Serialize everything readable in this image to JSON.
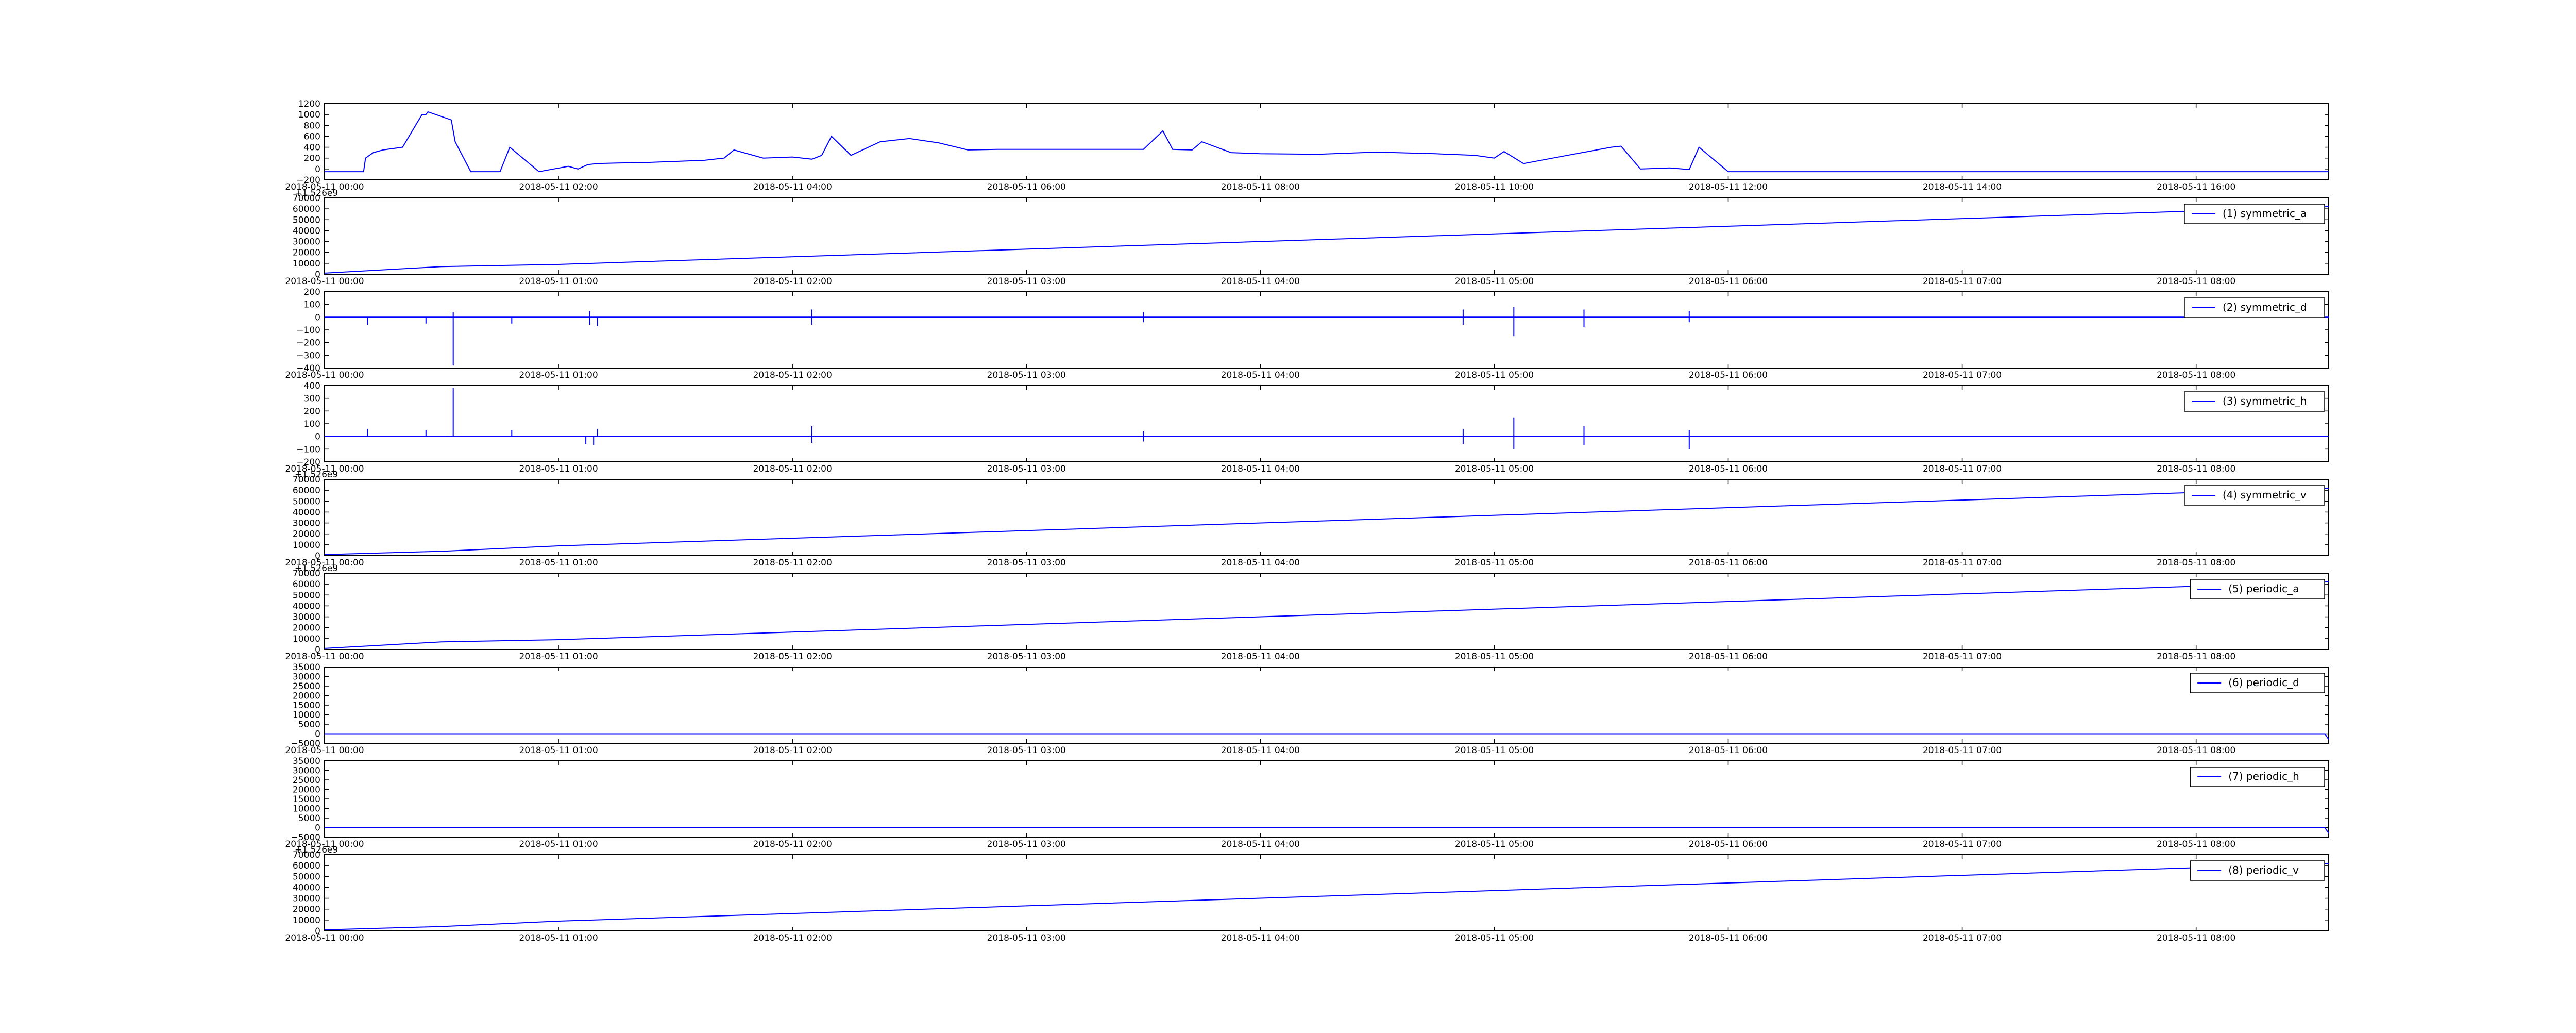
{
  "figure": {
    "background": "#ffffff",
    "line_color": "#0000ff",
    "frame_color": "#000000"
  },
  "chart_data": [
    {
      "type": "line",
      "x_unit": "datetime",
      "xticks": [
        "2018-05-11 00:00",
        "2018-05-11 02:00",
        "2018-05-11 04:00",
        "2018-05-11 06:00",
        "2018-05-11 08:00",
        "2018-05-11 10:00",
        "2018-05-11 12:00",
        "2018-05-11 14:00",
        "2018-05-11 16:00"
      ],
      "xlim": [
        "2018-05-11 00:00",
        "2018-05-11 17:08"
      ],
      "yticks": [
        "1200",
        "1000",
        "800",
        "600",
        "400",
        "200",
        "0",
        "−200"
      ],
      "ylim": [
        -200,
        1200
      ],
      "offset_text": "",
      "grid": false,
      "legend": null,
      "series": [
        {
          "x": [
            "2018-05-11 00:00",
            "2018-05-11 00:20",
            "2018-05-11 00:21",
            "2018-05-11 00:25",
            "2018-05-11 00:30",
            "2018-05-11 00:40",
            "2018-05-11 00:50",
            "2018-05-11 00:52",
            "2018-05-11 00:53",
            "2018-05-11 01:05",
            "2018-05-11 01:06",
            "2018-05-11 01:07",
            "2018-05-11 01:15",
            "2018-05-11 01:30",
            "2018-05-11 01:35",
            "2018-05-11 01:50",
            "2018-05-11 02:05",
            "2018-05-11 02:10",
            "2018-05-11 02:15",
            "2018-05-11 02:20",
            "2018-05-11 02:30",
            "2018-05-11 02:45",
            "2018-05-11 03:00",
            "2018-05-11 03:15",
            "2018-05-11 03:25",
            "2018-05-11 03:30",
            "2018-05-11 03:45",
            "2018-05-11 04:00",
            "2018-05-11 04:10",
            "2018-05-11 04:15",
            "2018-05-11 04:20",
            "2018-05-11 04:30",
            "2018-05-11 04:45",
            "2018-05-11 05:00",
            "2018-05-11 05:15",
            "2018-05-11 05:30",
            "2018-05-11 05:45",
            "2018-05-11 06:00",
            "2018-05-11 06:30",
            "2018-05-11 07:00",
            "2018-05-11 07:10",
            "2018-05-11 07:15",
            "2018-05-11 07:25",
            "2018-05-11 07:30",
            "2018-05-11 07:45",
            "2018-05-11 08:00",
            "2018-05-11 08:30",
            "2018-05-11 09:00",
            "2018-05-11 09:30",
            "2018-05-11 09:50",
            "2018-05-11 10:00",
            "2018-05-11 10:05",
            "2018-05-11 10:15",
            "2018-05-11 10:30",
            "2018-05-11 10:45",
            "2018-05-11 11:00",
            "2018-05-11 11:05",
            "2018-05-11 11:15",
            "2018-05-11 11:30",
            "2018-05-11 11:40",
            "2018-05-11 11:45",
            "2018-05-11 12:00",
            "2018-05-11 14:00",
            "2018-05-11 17:08"
          ],
          "y": [
            -50,
            -50,
            200,
            300,
            350,
            400,
            1000,
            1000,
            1050,
            900,
            700,
            500,
            -50,
            -50,
            400,
            -50,
            50,
            0,
            80,
            100,
            110,
            120,
            140,
            160,
            200,
            350,
            200,
            220,
            180,
            250,
            600,
            250,
            500,
            560,
            480,
            350,
            360,
            360,
            360,
            360,
            700,
            360,
            350,
            500,
            300,
            280,
            270,
            310,
            280,
            250,
            200,
            320,
            100,
            200,
            300,
            400,
            420,
            0,
            20,
            -10,
            400,
            -50,
            -50,
            -50
          ]
        }
      ]
    },
    {
      "type": "line",
      "xticks": [
        "2018-05-11 00:00",
        "2018-05-11 01:00",
        "2018-05-11 02:00",
        "2018-05-11 03:00",
        "2018-05-11 04:00",
        "2018-05-11 05:00",
        "2018-05-11 06:00",
        "2018-05-11 07:00",
        "2018-05-11 08:00"
      ],
      "xlim": [
        "2018-05-11 00:00",
        "2018-05-11 08:34"
      ],
      "yticks": [
        "70000",
        "60000",
        "50000",
        "40000",
        "30000",
        "20000",
        "10000",
        "0"
      ],
      "ylim": [
        0,
        70000
      ],
      "offset_text": "+1.526e9",
      "grid": false,
      "legend": {
        "label": "(1) symmetric_a",
        "position": "top-right"
      },
      "series": [
        {
          "name": "(1) symmetric_a",
          "x": [
            "2018-05-11 00:00",
            "2018-05-11 00:30",
            "2018-05-11 01:00",
            "2018-05-11 08:34"
          ],
          "y": [
            1000,
            7000,
            9000,
            62000
          ]
        }
      ]
    },
    {
      "type": "line",
      "xticks": [
        "2018-05-11 00:00",
        "2018-05-11 01:00",
        "2018-05-11 02:00",
        "2018-05-11 03:00",
        "2018-05-11 04:00",
        "2018-05-11 05:00",
        "2018-05-11 06:00",
        "2018-05-11 07:00",
        "2018-05-11 08:00"
      ],
      "xlim": [
        "2018-05-11 00:00",
        "2018-05-11 08:34"
      ],
      "yticks": [
        "200",
        "100",
        "0",
        "−100",
        "−200",
        "−300",
        "−400"
      ],
      "ylim": [
        -400,
        200
      ],
      "offset_text": "",
      "grid": false,
      "legend": {
        "label": "(2) symmetric_d",
        "position": "top-right"
      },
      "series": [
        {
          "name": "(2) symmetric_d",
          "x": [
            "2018-05-11 00:00",
            "2018-05-11 00:11",
            "2018-05-11 00:11",
            "2018-05-11 00:11",
            "2018-05-11 00:26",
            "2018-05-11 00:26",
            "2018-05-11 00:26",
            "2018-05-11 00:33",
            "2018-05-11 00:33",
            "2018-05-11 00:33",
            "2018-05-11 00:33",
            "2018-05-11 00:33",
            "2018-05-11 00:48",
            "2018-05-11 00:48",
            "2018-05-11 00:48",
            "2018-05-11 01:08",
            "2018-05-11 01:08",
            "2018-05-11 01:08",
            "2018-05-11 01:08",
            "2018-05-11 01:08",
            "2018-05-11 01:10",
            "2018-05-11 01:10",
            "2018-05-11 01:10",
            "2018-05-11 02:05",
            "2018-05-11 02:05",
            "2018-05-11 02:05",
            "2018-05-11 02:05",
            "2018-05-11 02:05",
            "2018-05-11 03:30",
            "2018-05-11 03:30",
            "2018-05-11 03:30",
            "2018-05-11 03:30",
            "2018-05-11 03:30",
            "2018-05-11 04:52",
            "2018-05-11 04:52",
            "2018-05-11 04:52",
            "2018-05-11 04:52",
            "2018-05-11 04:52",
            "2018-05-11 05:05",
            "2018-05-11 05:05",
            "2018-05-11 05:05",
            "2018-05-11 05:05",
            "2018-05-11 05:05",
            "2018-05-11 05:23",
            "2018-05-11 05:23",
            "2018-05-11 05:23",
            "2018-05-11 05:23",
            "2018-05-11 05:23",
            "2018-05-11 05:50",
            "2018-05-11 05:50",
            "2018-05-11 05:50",
            "2018-05-11 05:50",
            "2018-05-11 05:50",
            "2018-05-11 08:34"
          ],
          "y": [
            0,
            0,
            -60,
            0,
            0,
            -50,
            0,
            0,
            -380,
            0,
            40,
            0,
            0,
            -50,
            0,
            0,
            50,
            0,
            -60,
            0,
            0,
            -70,
            0,
            0,
            60,
            0,
            -60,
            0,
            0,
            40,
            0,
            -40,
            0,
            0,
            60,
            0,
            -60,
            0,
            0,
            80,
            0,
            -150,
            0,
            0,
            60,
            0,
            -80,
            0,
            0,
            50,
            0,
            -40,
            0,
            0
          ]
        }
      ]
    },
    {
      "type": "line",
      "xticks": [
        "2018-05-11 00:00",
        "2018-05-11 01:00",
        "2018-05-11 02:00",
        "2018-05-11 03:00",
        "2018-05-11 04:00",
        "2018-05-11 05:00",
        "2018-05-11 06:00",
        "2018-05-11 07:00",
        "2018-05-11 08:00"
      ],
      "xlim": [
        "2018-05-11 00:00",
        "2018-05-11 08:34"
      ],
      "yticks": [
        "400",
        "300",
        "200",
        "100",
        "0",
        "−100",
        "−200"
      ],
      "ylim": [
        -200,
        400
      ],
      "offset_text": "",
      "grid": false,
      "legend": {
        "label": "(3) symmetric_h",
        "position": "top-right"
      },
      "series": [
        {
          "name": "(3) symmetric_h",
          "x": [
            "2018-05-11 00:00",
            "2018-05-11 00:11",
            "2018-05-11 00:11",
            "2018-05-11 00:11",
            "2018-05-11 00:26",
            "2018-05-11 00:26",
            "2018-05-11 00:26",
            "2018-05-11 00:33",
            "2018-05-11 00:33",
            "2018-05-11 00:33",
            "2018-05-11 00:48",
            "2018-05-11 00:48",
            "2018-05-11 00:48",
            "2018-05-11 01:07",
            "2018-05-11 01:07",
            "2018-05-11 01:07",
            "2018-05-11 01:09",
            "2018-05-11 01:09",
            "2018-05-11 01:09",
            "2018-05-11 01:10",
            "2018-05-11 01:10",
            "2018-05-11 01:10",
            "2018-05-11 02:05",
            "2018-05-11 02:05",
            "2018-05-11 02:05",
            "2018-05-11 02:05",
            "2018-05-11 02:05",
            "2018-05-11 03:30",
            "2018-05-11 03:30",
            "2018-05-11 03:30",
            "2018-05-11 03:30",
            "2018-05-11 03:30",
            "2018-05-11 04:52",
            "2018-05-11 04:52",
            "2018-05-11 04:52",
            "2018-05-11 04:52",
            "2018-05-11 04:52",
            "2018-05-11 05:05",
            "2018-05-11 05:05",
            "2018-05-11 05:05",
            "2018-05-11 05:05",
            "2018-05-11 05:05",
            "2018-05-11 05:23",
            "2018-05-11 05:23",
            "2018-05-11 05:23",
            "2018-05-11 05:23",
            "2018-05-11 05:23",
            "2018-05-11 05:50",
            "2018-05-11 05:50",
            "2018-05-11 05:50",
            "2018-05-11 05:50",
            "2018-05-11 05:50",
            "2018-05-11 08:34"
          ],
          "y": [
            0,
            0,
            60,
            0,
            0,
            50,
            0,
            0,
            380,
            0,
            0,
            50,
            0,
            0,
            -60,
            0,
            0,
            -70,
            0,
            0,
            60,
            0,
            0,
            80,
            0,
            -50,
            0,
            0,
            40,
            0,
            -40,
            0,
            0,
            60,
            0,
            -60,
            0,
            0,
            150,
            0,
            -100,
            0,
            0,
            80,
            0,
            -70,
            0,
            0,
            50,
            0,
            -100,
            0,
            0
          ]
        }
      ]
    },
    {
      "type": "line",
      "xticks": [
        "2018-05-11 00:00",
        "2018-05-11 01:00",
        "2018-05-11 02:00",
        "2018-05-11 03:00",
        "2018-05-11 04:00",
        "2018-05-11 05:00",
        "2018-05-11 06:00",
        "2018-05-11 07:00",
        "2018-05-11 08:00"
      ],
      "xlim": [
        "2018-05-11 00:00",
        "2018-05-11 08:34"
      ],
      "yticks": [
        "70000",
        "60000",
        "50000",
        "40000",
        "30000",
        "20000",
        "10000",
        "0"
      ],
      "ylim": [
        0,
        70000
      ],
      "offset_text": "+1.526e9",
      "grid": false,
      "legend": {
        "label": "(4) symmetric_v",
        "position": "top-right"
      },
      "series": [
        {
          "name": "(4) symmetric_v",
          "x": [
            "2018-05-11 00:00",
            "2018-05-11 00:30",
            "2018-05-11 01:00",
            "2018-05-11 08:34"
          ],
          "y": [
            1000,
            4000,
            9000,
            62000
          ]
        }
      ]
    },
    {
      "type": "line",
      "xticks": [
        "2018-05-11 00:00",
        "2018-05-11 01:00",
        "2018-05-11 02:00",
        "2018-05-11 03:00",
        "2018-05-11 04:00",
        "2018-05-11 05:00",
        "2018-05-11 06:00",
        "2018-05-11 07:00",
        "2018-05-11 08:00"
      ],
      "xlim": [
        "2018-05-11 00:00",
        "2018-05-11 08:34"
      ],
      "yticks": [
        "70000",
        "60000",
        "50000",
        "40000",
        "30000",
        "20000",
        "10000",
        "0"
      ],
      "ylim": [
        0,
        70000
      ],
      "offset_text": "+1.526e9",
      "grid": false,
      "legend": {
        "label": "(5) periodic_a",
        "position": "top-right"
      },
      "series": [
        {
          "name": "(5) periodic_a",
          "x": [
            "2018-05-11 00:00",
            "2018-05-11 00:30",
            "2018-05-11 01:00",
            "2018-05-11 08:34"
          ],
          "y": [
            1000,
            7000,
            9000,
            62000
          ]
        }
      ]
    },
    {
      "type": "line",
      "xticks": [
        "2018-05-11 00:00",
        "2018-05-11 01:00",
        "2018-05-11 02:00",
        "2018-05-11 03:00",
        "2018-05-11 04:00",
        "2018-05-11 05:00",
        "2018-05-11 06:00",
        "2018-05-11 07:00",
        "2018-05-11 08:00"
      ],
      "xlim": [
        "2018-05-11 00:00",
        "2018-05-11 08:34"
      ],
      "yticks": [
        "35000",
        "30000",
        "25000",
        "20000",
        "15000",
        "10000",
        "5000",
        "0",
        "−5000"
      ],
      "ylim": [
        -5000,
        35000
      ],
      "offset_text": "",
      "grid": false,
      "legend": {
        "label": "(6) periodic_d",
        "position": "top-right"
      },
      "series": [
        {
          "name": "(6) periodic_d",
          "x": [
            "2018-05-11 00:00",
            "2018-05-11 08:33",
            "2018-05-11 08:34"
          ],
          "y": [
            0,
            0,
            -3000
          ]
        }
      ]
    },
    {
      "type": "line",
      "xticks": [
        "2018-05-11 00:00",
        "2018-05-11 01:00",
        "2018-05-11 02:00",
        "2018-05-11 03:00",
        "2018-05-11 04:00",
        "2018-05-11 05:00",
        "2018-05-11 06:00",
        "2018-05-11 07:00",
        "2018-05-11 08:00"
      ],
      "xlim": [
        "2018-05-11 00:00",
        "2018-05-11 08:34"
      ],
      "yticks": [
        "35000",
        "30000",
        "25000",
        "20000",
        "15000",
        "10000",
        "5000",
        "0",
        "−5000"
      ],
      "ylim": [
        -5000,
        35000
      ],
      "offset_text": "",
      "grid": false,
      "legend": {
        "label": "(7) periodic_h",
        "position": "top-right"
      },
      "series": [
        {
          "name": "(7) periodic_h",
          "x": [
            "2018-05-11 00:00",
            "2018-05-11 08:33",
            "2018-05-11 08:34"
          ],
          "y": [
            0,
            0,
            -3000
          ]
        }
      ]
    },
    {
      "type": "line",
      "xticks": [
        "2018-05-11 00:00",
        "2018-05-11 01:00",
        "2018-05-11 02:00",
        "2018-05-11 03:00",
        "2018-05-11 04:00",
        "2018-05-11 05:00",
        "2018-05-11 06:00",
        "2018-05-11 07:00",
        "2018-05-11 08:00"
      ],
      "xlim": [
        "2018-05-11 00:00",
        "2018-05-11 08:34"
      ],
      "yticks": [
        "70000",
        "60000",
        "50000",
        "40000",
        "30000",
        "20000",
        "10000",
        "0"
      ],
      "ylim": [
        0,
        70000
      ],
      "offset_text": "+1.526e9",
      "grid": false,
      "legend": {
        "label": "(8) periodic_v",
        "position": "top-right"
      },
      "series": [
        {
          "name": "(8) periodic_v",
          "x": [
            "2018-05-11 00:00",
            "2018-05-11 00:30",
            "2018-05-11 01:00",
            "2018-05-11 08:34"
          ],
          "y": [
            1000,
            4000,
            9000,
            62000
          ]
        }
      ]
    }
  ]
}
